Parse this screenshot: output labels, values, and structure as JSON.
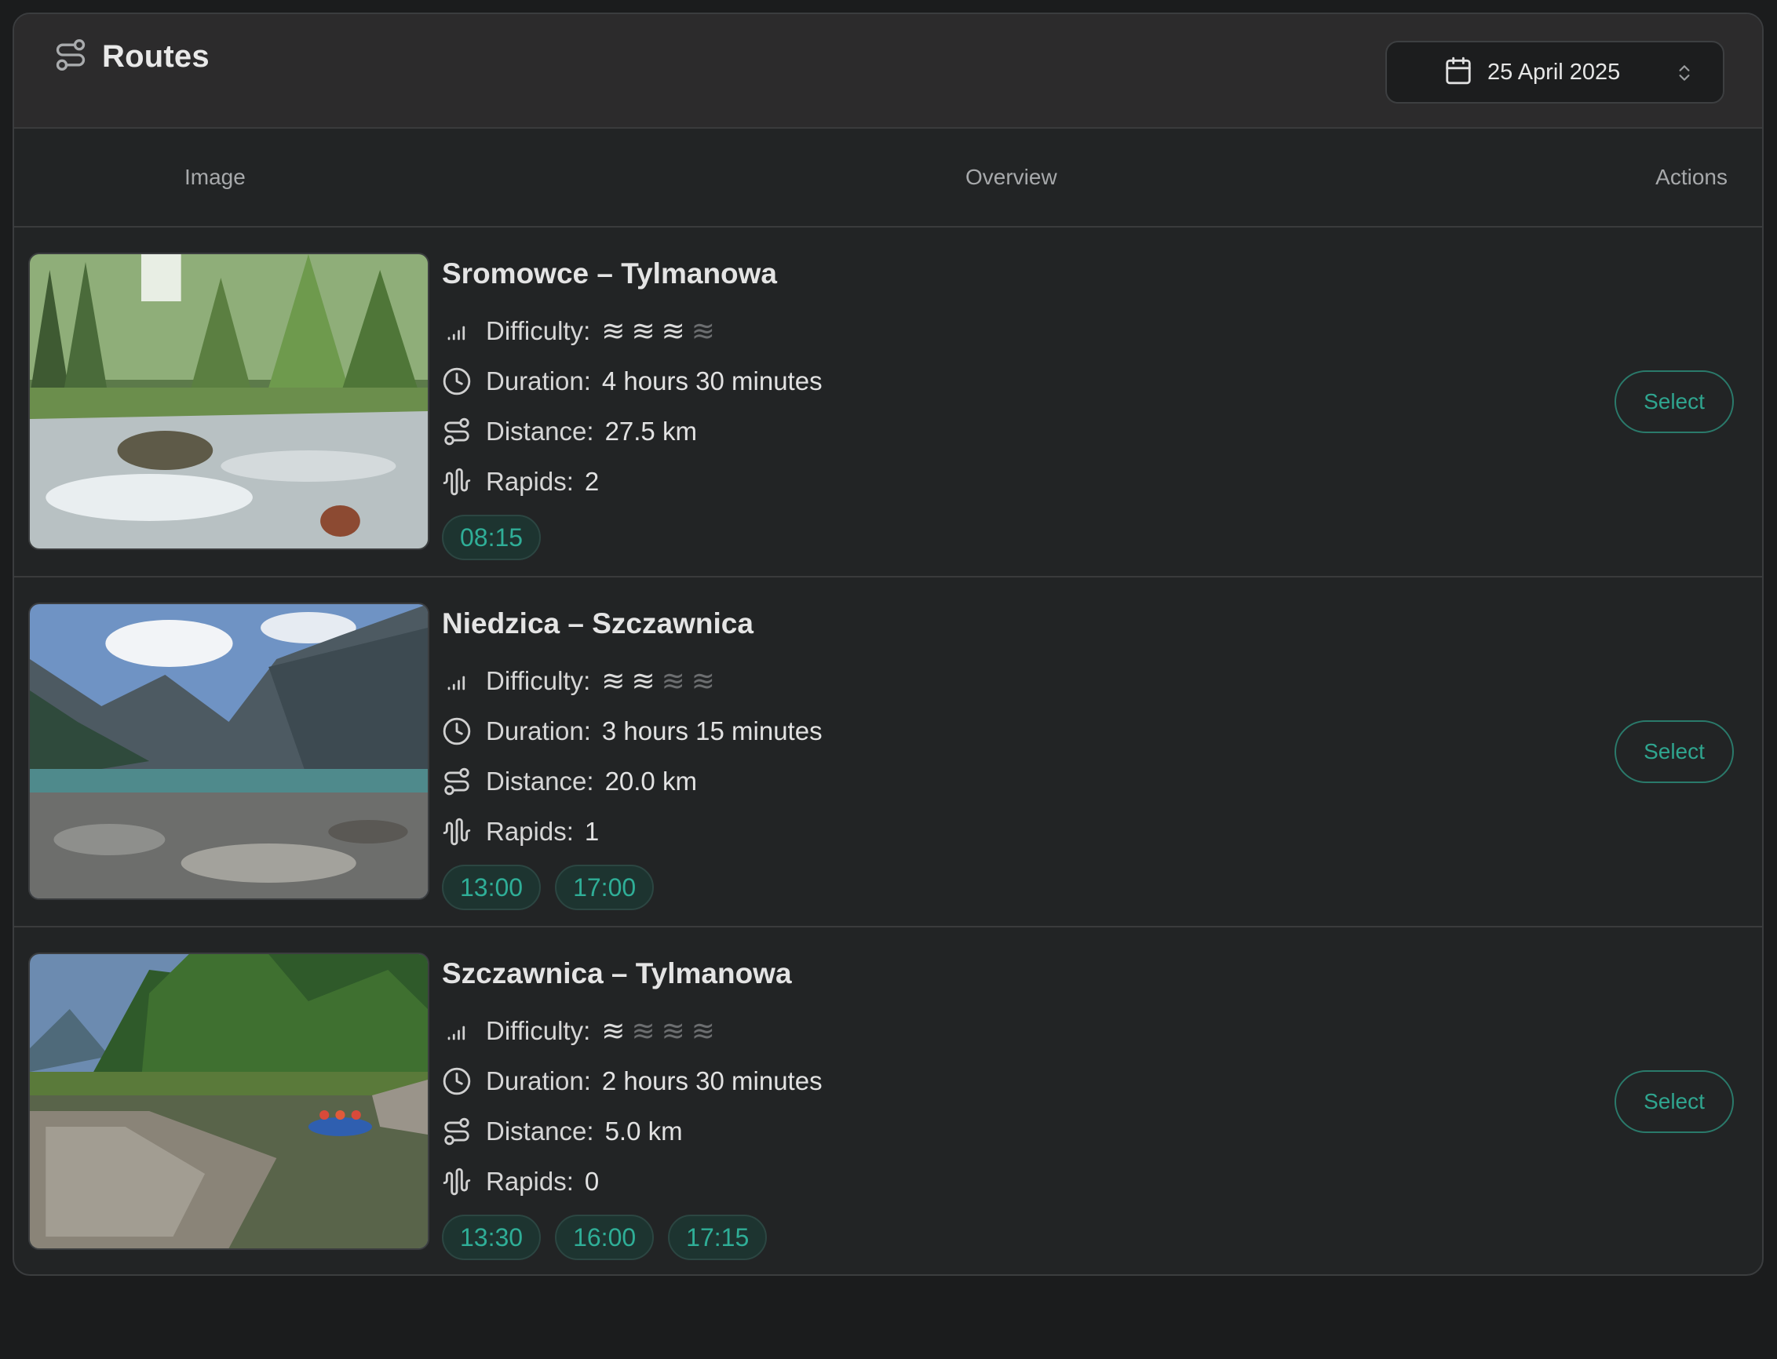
{
  "header": {
    "title": "Routes",
    "title_icon": "route-icon",
    "date_value": "25 April 2025",
    "date_icon": "calendar-icon",
    "date_toggle_icon": "chevron-updown-icon"
  },
  "columns": {
    "image": "Image",
    "overview": "Overview",
    "actions": "Actions"
  },
  "labels": {
    "difficulty": "Difficulty:",
    "duration": "Duration:",
    "distance": "Distance:",
    "rapids": "Rapids:"
  },
  "difficulty_glyph": "≋",
  "difficulty_max": 4,
  "colors": {
    "accent": "#2fae97",
    "chip_bg": "#1d3430",
    "background": "#1b1c1d",
    "card": "#222425",
    "header": "#2c2b2c"
  },
  "routes": [
    {
      "name": "Sromowce – Tylmanowa",
      "difficulty": 3,
      "duration": "4 hours 30 minutes",
      "distance": "27.5 km",
      "rapids": "2",
      "times": [
        "08:15"
      ],
      "image": "forest-river-photo",
      "action_label": "Select"
    },
    {
      "name": "Niedzica – Szczawnica",
      "difficulty": 2,
      "duration": "3 hours 15 minutes",
      "distance": "20.0 km",
      "rapids": "1",
      "times": [
        "13:00",
        "17:00"
      ],
      "image": "mountain-lake-photo",
      "action_label": "Select"
    },
    {
      "name": "Szczawnica – Tylmanowa",
      "difficulty": 1,
      "duration": "2 hours 30 minutes",
      "distance": "5.0 km",
      "rapids": "0",
      "times": [
        "13:30",
        "16:00",
        "17:15"
      ],
      "image": "rafting-river-photo",
      "action_label": "Select"
    }
  ]
}
